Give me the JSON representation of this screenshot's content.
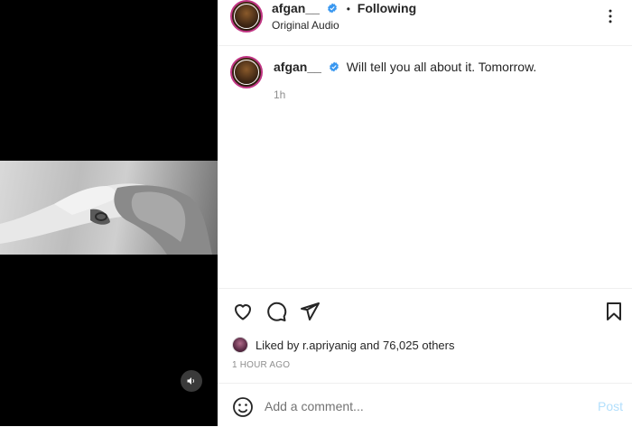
{
  "header": {
    "username": "afgan__",
    "separator": "•",
    "follow_status": "Following",
    "audio": "Original Audio"
  },
  "caption": {
    "username": "afgan__",
    "text": "Will tell you all about it. Tomorrow.",
    "time": "1h"
  },
  "likes": {
    "prefix": "Liked by",
    "user": "r.apriyanig",
    "joiner": "and",
    "others": "76,025 others"
  },
  "posted_time": "1 HOUR AGO",
  "comment": {
    "placeholder": "Add a comment...",
    "post_label": "Post"
  },
  "colors": {
    "verified": "#3897f0",
    "post_disabled": "#b2dffc",
    "meta_text": "#8e8e8e"
  },
  "icons": {
    "more": "more-options-icon",
    "like": "heart-icon",
    "comment": "comment-icon",
    "share": "send-icon",
    "save": "bookmark-icon",
    "emoji": "emoji-icon",
    "sound": "speaker-icon",
    "verified": "verified-badge-icon"
  }
}
